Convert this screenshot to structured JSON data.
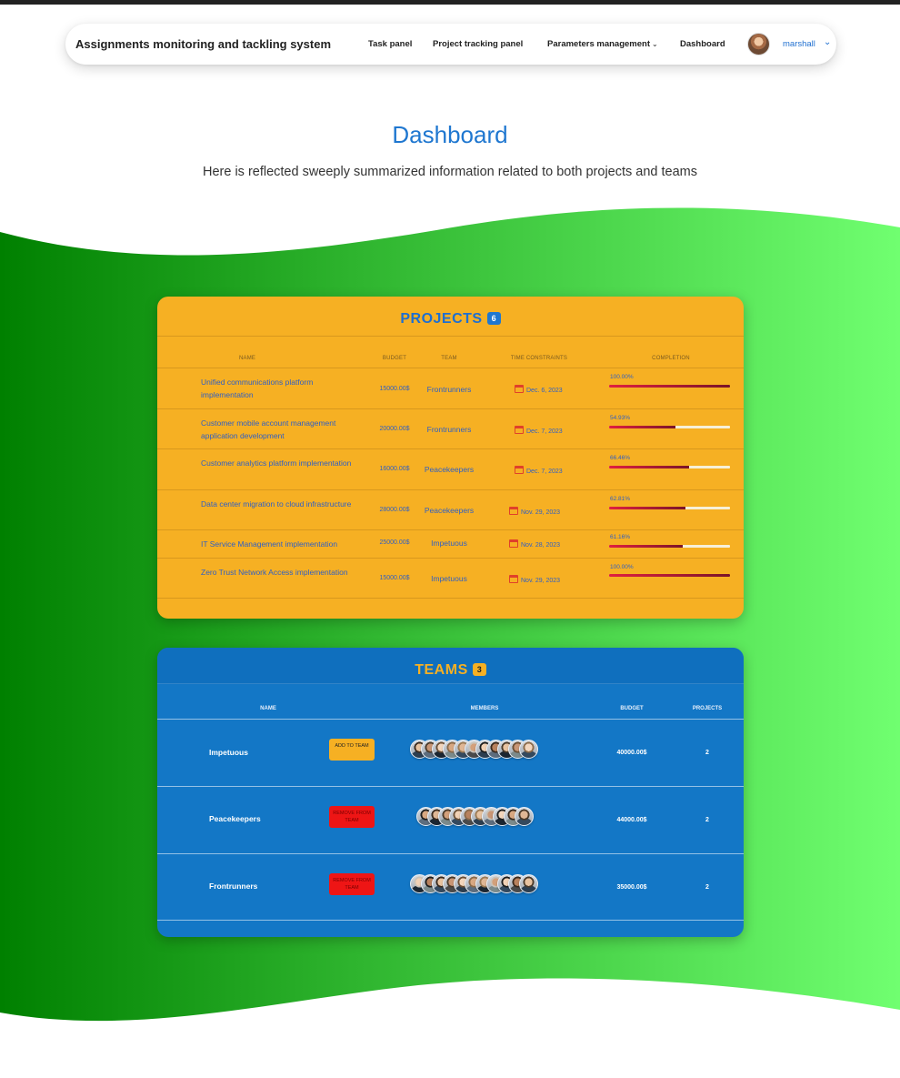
{
  "nav": {
    "brand": "Assignments monitoring and tackling system",
    "links": [
      {
        "label": "Task panel"
      },
      {
        "label": "Project tracking panel"
      },
      {
        "label": "Parameters management"
      },
      {
        "label": "Dashboard"
      }
    ],
    "user": "marshall",
    "dropdown_icon": "chevron-down-icon"
  },
  "header": {
    "title": "Dashboard",
    "subtitle": "Here is reflected sweeply summarized information related to both projects and teams"
  },
  "colors": {
    "accent_blue": "#1f77d0",
    "projects_card": "#f6b023",
    "teams_card": "#1377c6",
    "wave_start": "#008000",
    "wave_end": "#70ff70",
    "remove_button": "#ee1515"
  },
  "projects": {
    "title": "PROJECTS",
    "count": "6",
    "columns": [
      "NAME",
      "BUDGET",
      "TEAM",
      "TIME CONSTRAINTS",
      "COMPLETION"
    ],
    "rows": [
      {
        "name": "Unified communications platform implementation",
        "budget": "15000.00$",
        "team": "Frontrunners",
        "date": "Dec. 6, 2023",
        "completion": "100.00%",
        "completion_value": 100.0
      },
      {
        "name": "Customer mobile account management application development",
        "budget": "20000.00$",
        "team": "Frontrunners",
        "date": "Dec. 7, 2023",
        "completion": "54.93%",
        "completion_value": 54.93
      },
      {
        "name": "Customer analytics platform implementation",
        "budget": "16000.00$",
        "team": "Peacekeepers",
        "date": "Dec. 7, 2023",
        "completion": "66.46%",
        "completion_value": 66.46
      },
      {
        "name": "Data center migration to cloud infrastructure",
        "budget": "28000.00$",
        "team": "Peacekeepers",
        "date": "Nov. 29, 2023",
        "completion": "62.81%",
        "completion_value": 62.81
      },
      {
        "name": "IT Service Management implementation",
        "budget": "25000.00$",
        "team": "Impetuous",
        "date": "Nov. 28, 2023",
        "completion": "61.16%",
        "completion_value": 61.16
      },
      {
        "name": "Zero Trust Network Access implementation",
        "budget": "15000.00$",
        "team": "Impetuous",
        "date": "Nov. 29, 2023",
        "completion": "100.00%",
        "completion_value": 100.0
      }
    ]
  },
  "teams": {
    "title": "TEAMS",
    "count": "3",
    "columns": [
      "NAME",
      "MEMBERS",
      "BUDGET",
      "PROJECTS"
    ],
    "rows": [
      {
        "name": "Impetuous",
        "action": "ADD TO TEAM",
        "action_type": "add",
        "member_count": 11,
        "budget": "40000.00$",
        "projects": "2"
      },
      {
        "name": "Peacekeepers",
        "action": "REMOVE FROM TEAM",
        "action_type": "remove",
        "member_count": 10,
        "budget": "44000.00$",
        "projects": "2"
      },
      {
        "name": "Frontrunners",
        "action": "REMOVE FROM TEAM",
        "action_type": "remove",
        "member_count": 11,
        "budget": "35000.00$",
        "projects": "2"
      }
    ]
  }
}
